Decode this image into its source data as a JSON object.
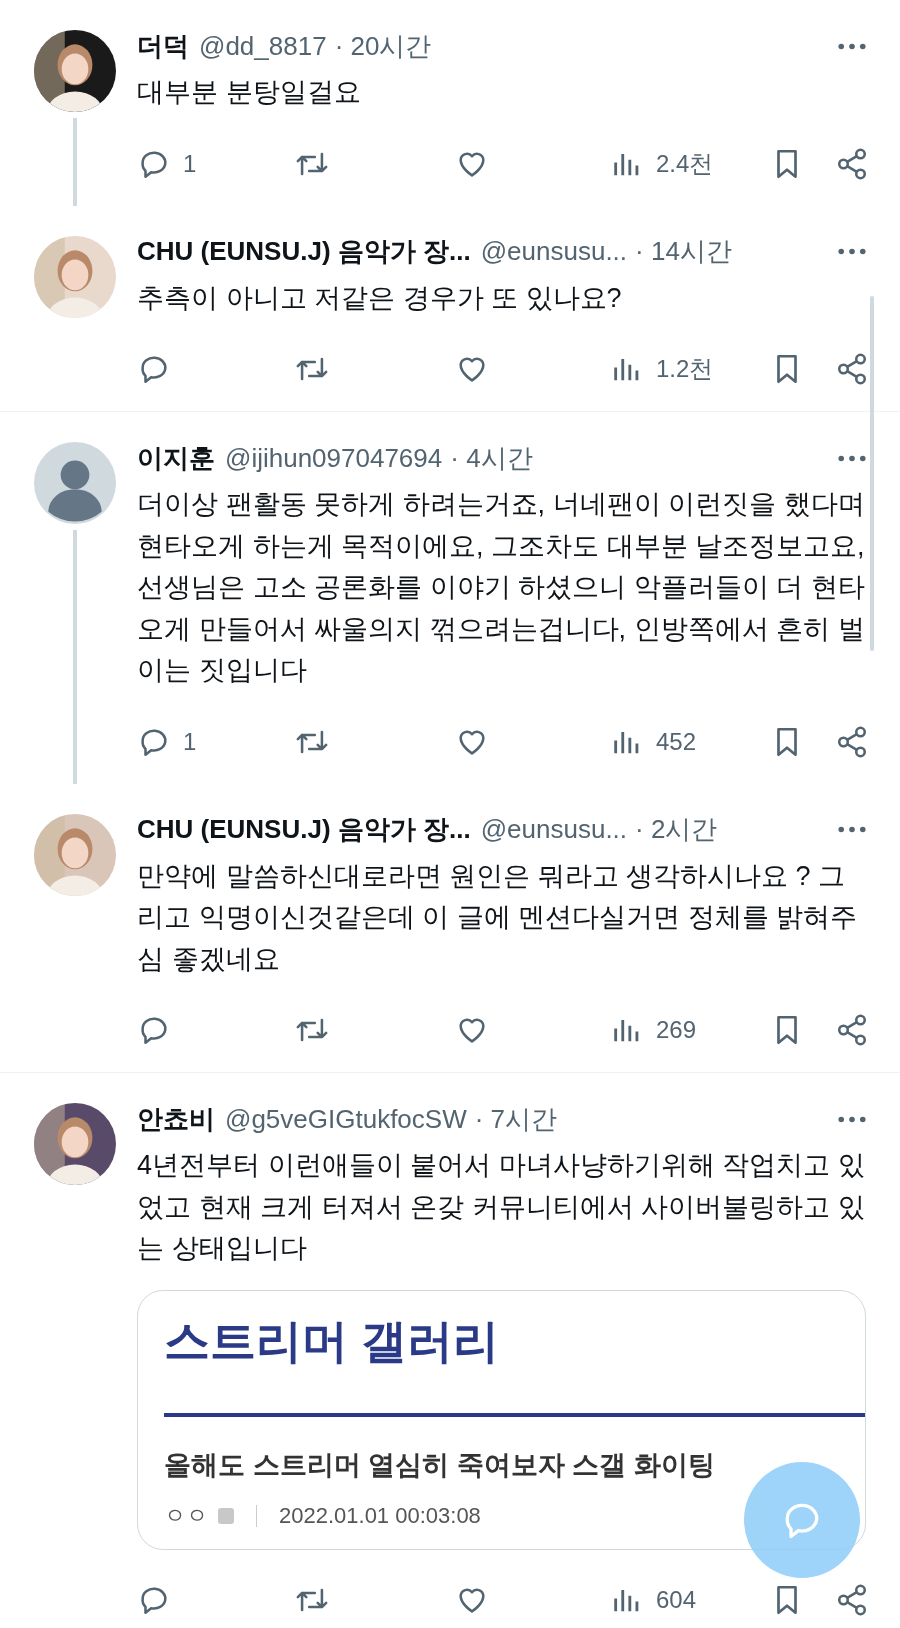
{
  "threads": [
    {
      "tweets": [
        {
          "avatar": {
            "kind": "photo"
          },
          "name": "더덕",
          "handle": "@dd_8817",
          "time": "· 20시간",
          "text": "대부분 분탕일걸요",
          "stats": {
            "replies": "1",
            "views": "2.4천"
          }
        },
        {
          "avatar": {
            "kind": "photo"
          },
          "name": "CHU (EUNSU.J) 음악가 장...",
          "handle": "@eunsusu...",
          "time": "· 14시간",
          "text": "추측이 아니고 저같은 경우가 또 있나요?",
          "stats": {
            "views": "1.2천"
          }
        }
      ]
    },
    {
      "tweets": [
        {
          "avatar": {
            "kind": "default"
          },
          "name": "이지훈",
          "handle": "@ijihun097047694",
          "time": "· 4시간",
          "text": "더이상 팬활동 못하게 하려는거죠, 너네팬이 이런짓을 했다며 현타오게 하는게 목적이에요, 그조차도 대부분 날조정보고요, 선생님은 고소 공론화를 이야기 하셨으니 악플러들이 더 현타오게 만들어서 싸울의지 꺾으려는겁니다, 인방쪽에서 흔히 벌이는 짓입니다",
          "stats": {
            "replies": "1",
            "views": "452"
          }
        },
        {
          "avatar": {
            "kind": "photo"
          },
          "name": "CHU (EUNSU.J) 음악가 장...",
          "handle": "@eunsusu...",
          "time": "· 2시간",
          "text": "만약에 말씀하신대로라면 원인은 뭐라고 생각하시나요 ? 그리고 익명이신것같은데 이 글에 멘션다실거면 정체를 밝혀주심 좋겠네요",
          "stats": {
            "views": "269"
          }
        }
      ]
    },
    {
      "tweets": [
        {
          "avatar": {
            "kind": "photo"
          },
          "name": "안쵸비",
          "handle": "@g5veGIGtukfocSW",
          "time": "· 7시간",
          "text": "4년전부터 이런애들이 붙어서 마녀사냥하기위해 작업치고 있었고 현재 크게 터져서 온갖 커뮤니티에서 사이버불링하고 있는 상태입니다",
          "card": {
            "title": "스트리머 갤러리",
            "subtitle": "올해도 스트리머 열심히 죽여보자 스갤 화이팅",
            "author": "ㅇㅇ",
            "date": "2022.01.01 00:03:08"
          },
          "stats": {
            "views": "604"
          }
        }
      ]
    }
  ]
}
